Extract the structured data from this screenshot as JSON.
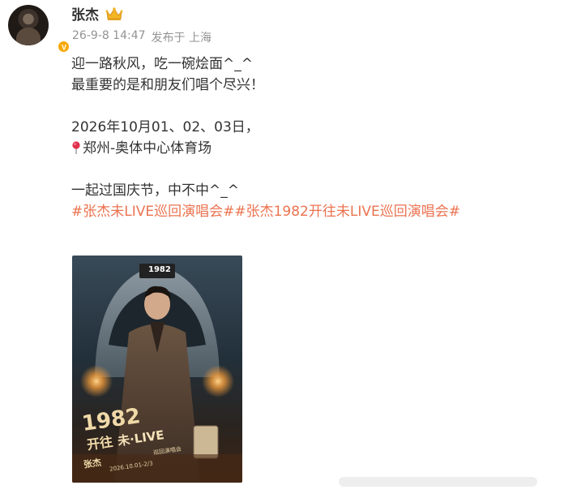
{
  "author": {
    "name": "张杰",
    "verified_color": "#f7a90a",
    "crown_icon": "crown-icon"
  },
  "meta": {
    "time": "26-9-8 14:47",
    "location": "发布于 上海"
  },
  "content": {
    "lines": [
      "迎一路秋风，吃一碗烩面^_^",
      "最重要的是和朋友们唱个尽兴！",
      "",
      "2026年10月01、02、03日，",
      "郑州-奥体中心体育场",
      "",
      "一起过国庆节，中不中^_^"
    ],
    "tags": [
      "#张杰未LIVE巡回演唱会#",
      "#张杰1982开往未LIVE巡回演唱会#"
    ],
    "tag_color": "#eb7350",
    "location_pin_icon": "location-pin-icon"
  },
  "poster": {
    "train_number": "1982",
    "title_main": "1982",
    "title_sub": "开往",
    "title_live": "未·LIVE",
    "subtitle": "巡回演唱会",
    "artist": "张杰",
    "dates": "2026.10.01-2/3"
  }
}
